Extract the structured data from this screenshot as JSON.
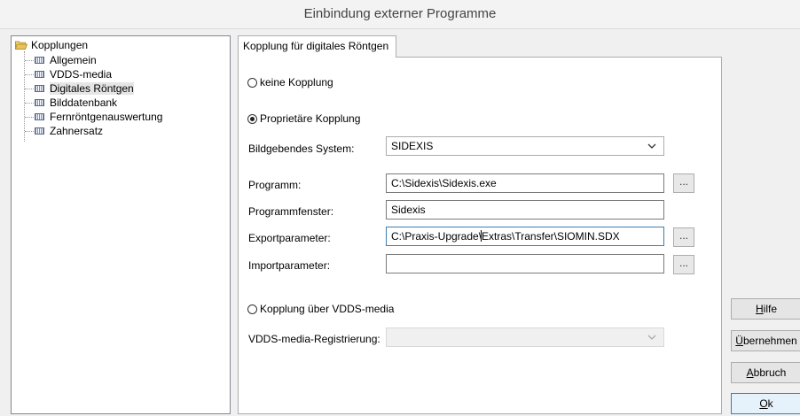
{
  "window": {
    "title": "Einbindung externer Programme"
  },
  "tree": {
    "root": "Kopplungen",
    "items": [
      {
        "label": "Allgemein",
        "selected": false
      },
      {
        "label": "VDDS-media",
        "selected": false
      },
      {
        "label": "Digitales Röntgen",
        "selected": true
      },
      {
        "label": "Bilddatenbank",
        "selected": false
      },
      {
        "label": "Fernröntgenauswertung",
        "selected": false
      },
      {
        "label": "Zahnersatz",
        "selected": false
      }
    ]
  },
  "tab": {
    "label": "Kopplung für digitales Röntgen"
  },
  "form": {
    "radio_none": "keine Kopplung",
    "radio_proprietary": "Proprietäre Kopplung",
    "selected_radio": "Proprietäre Kopplung",
    "imaging_system_label": "Bildgebendes System:",
    "imaging_system_value": "SIDEXIS",
    "program_label": "Programm:",
    "program_value": "C:\\Sidexis\\Sidexis.exe",
    "program_window_label": "Programmfenster:",
    "program_window_value": "Sidexis",
    "export_label": "Exportparameter:",
    "export_value": "C:\\Praxis-Upgrade\\Extras\\Transfer\\SIOMIN.SDX",
    "import_label": "Importparameter:",
    "import_value": "",
    "browse_label": "...",
    "radio_vdds": "Kopplung über VDDS-media",
    "vdds_registration_label": "VDDS-media-Registrierung:",
    "vdds_registration_value": ""
  },
  "buttons": {
    "help": {
      "underlined": "H",
      "rest": "ilfe"
    },
    "apply": {
      "underlined": "Ü",
      "rest": "bernehmen"
    },
    "cancel": {
      "underlined": "A",
      "rest": "bbruch"
    },
    "ok": {
      "underlined": "O",
      "rest": "k"
    }
  },
  "icons": {
    "tree_root": "folder-open-icon",
    "tree_item": "list-node-icon",
    "dropdown": "chevron-down-icon"
  },
  "colors": {
    "accent": "#3c7fb1",
    "folder": "#e8c25a"
  }
}
